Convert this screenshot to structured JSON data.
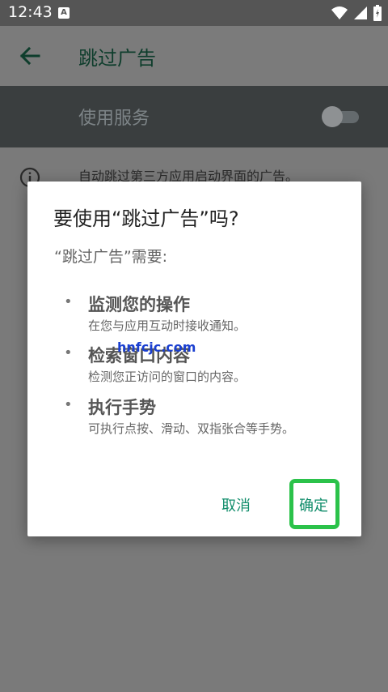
{
  "status_bar": {
    "time": "12:43",
    "notification_icon_letter": "A",
    "icons": [
      "wifi-icon",
      "signal-icon",
      "battery-icon"
    ]
  },
  "app_bar": {
    "title": "跳过广告",
    "back_icon": "arrow-left-icon"
  },
  "service": {
    "label": "使用服务",
    "enabled": false
  },
  "info": {
    "icon": "info-icon",
    "text": "自动跳过第三方应用启动界面的广告。"
  },
  "dialog": {
    "title": "要使用“跳过广告”吗?",
    "subtitle": "“跳过广告”需要:",
    "permissions": [
      {
        "title": "监测您的操作",
        "description": "在您与应用互动时接收通知。"
      },
      {
        "title": "检索窗口内容",
        "description": "检测您正访问的窗口的内容。"
      },
      {
        "title": "执行手势",
        "description": "可执行点按、滑动、双指张合等手势。"
      }
    ],
    "cancel_label": "取消",
    "ok_label": "确定"
  },
  "watermark": "hnfcjc.com",
  "colors": {
    "accent": "#0f8c6a",
    "highlight": "#2bc24a",
    "scrim": "#7a7a7a"
  }
}
